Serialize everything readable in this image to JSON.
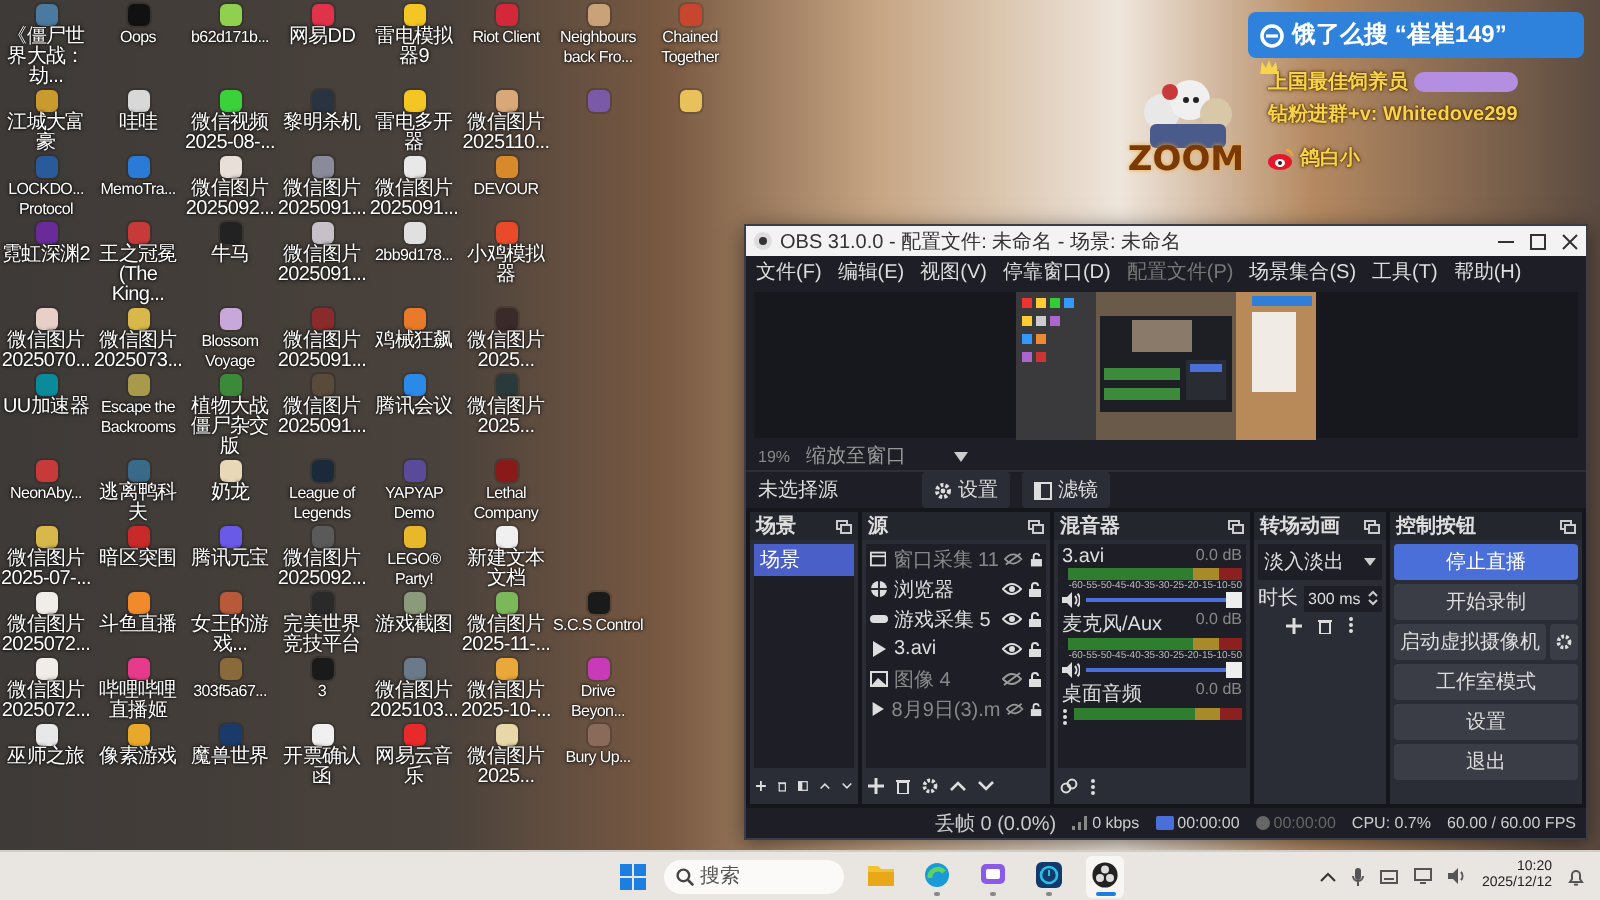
{
  "desktop": {
    "rows": [
      [
        {
          "label": "《僵尸世界大战：劫...",
          "color": "#4a7aa0"
        },
        {
          "label": "Oops",
          "color": "#111111"
        },
        {
          "label": "b62d171b...",
          "color": "#8fd14f"
        },
        {
          "label": "网易DD",
          "color": "#e0334a"
        },
        {
          "label": "雷电模拟器9",
          "color": "#f3c623"
        },
        {
          "label": "Riot Client",
          "color": "#d3283a"
        },
        {
          "label": "Neighbours back Fro...",
          "color": "#c9a27a"
        },
        {
          "label": "Chained Together",
          "color": "#c8462e"
        }
      ],
      [
        {
          "label": "江城大富豪",
          "color": "#c99a2e"
        },
        {
          "label": "哇哇",
          "color": "#d8d8d8"
        },
        {
          "label": "微信视频 2025-08-...",
          "color": "#3bd13b"
        },
        {
          "label": "黎明杀机",
          "color": "#2a3440"
        },
        {
          "label": "雷电多开器",
          "color": "#f3c623"
        },
        {
          "label": "微信图片 2025110...",
          "color": "#d9a878"
        },
        {
          "color": "#7a5aa8"
        },
        {
          "color": "#e8c15a"
        }
      ],
      [
        {
          "label": "LOCKDO... Protocol",
          "color": "#2a5a9a"
        },
        {
          "label": "MemoTra...",
          "color": "#2a7ad8"
        },
        {
          "label": "微信图片 2025092...",
          "color": "#e8e0d8"
        },
        {
          "label": "微信图片 2025091...",
          "color": "#8a8a9a"
        },
        {
          "label": "微信图片 2025091...",
          "color": "#e8e8e8"
        },
        {
          "label": "DEVOUR",
          "color": "#d88a2a"
        }
      ],
      [
        {
          "label": "霓虹深渊2",
          "color": "#6a2a9a"
        },
        {
          "label": "王之冠冕 (The King...",
          "color": "#c83a3a"
        },
        {
          "label": "牛马",
          "color": "#222222"
        },
        {
          "label": "微信图片 2025091...",
          "color": "#c8c0c8"
        },
        {
          "label": "2bb9d178...",
          "color": "#e0e0e0"
        },
        {
          "label": "小鸡模拟器",
          "color": "#e84a2a"
        }
      ],
      [
        {
          "label": "微信图片 2025070...",
          "color": "#e8d0c8"
        },
        {
          "label": "微信图片 2025073...",
          "color": "#d8b84a"
        },
        {
          "label": "Blossom Voyage",
          "color": "#c8a8d8"
        },
        {
          "label": "微信图片 2025091...",
          "color": "#8a2a2a"
        },
        {
          "label": "鸡械狂飙",
          "color": "#e87a2a"
        },
        {
          "label": "微信图片 2025...",
          "color": "#3a2a2a"
        }
      ],
      [
        {
          "label": "UU加速器",
          "color": "#0a8a9a"
        },
        {
          "label": "Escape the Backrooms",
          "color": "#a89a4a"
        },
        {
          "label": "植物大战僵尸杂交版",
          "color": "#3a8a3a"
        },
        {
          "label": "微信图片 2025091...",
          "color": "#5a4a3a"
        },
        {
          "label": "腾讯会议",
          "color": "#2a8ae8"
        },
        {
          "label": "微信图片 2025...",
          "color": "#2a3a3a"
        }
      ],
      [
        {
          "label": "NeonAby...",
          "color": "#c83a3a"
        },
        {
          "label": "逃离鸭科夫",
          "color": "#3a6a8a"
        },
        {
          "label": "奶龙",
          "color": "#e8d8b8"
        },
        {
          "label": "League of Legends",
          "color": "#1a2a3a"
        },
        {
          "label": "YAPYAP Demo",
          "color": "#5a4a9a"
        },
        {
          "label": "Lethal Company",
          "color": "#8a1a1a"
        }
      ],
      [
        {
          "label": "微信图片 2025-07-...",
          "color": "#d8b84a"
        },
        {
          "label": "暗区突围",
          "color": "#c82a2a"
        },
        {
          "label": "腾讯元宝",
          "color": "#6a5ae8"
        },
        {
          "label": "微信图片 2025092...",
          "color": "#5a5a5a"
        },
        {
          "label": "LEGO® Party!",
          "color": "#e8b82a"
        },
        {
          "label": "新建文本文档",
          "color": "#f0f0f0"
        }
      ],
      [
        {
          "label": "微信图片 2025072...",
          "color": "#f0ece8"
        },
        {
          "label": "斗鱼直播",
          "color": "#f08a2a"
        },
        {
          "label": "女王的游戏...",
          "color": "#b85a3a"
        },
        {
          "label": "完美世界竞技平台",
          "color": "#2a2a2a"
        },
        {
          "label": "游戏截图",
          "color": "#8a9a7a"
        },
        {
          "label": "微信图片 2025-11-...",
          "color": "#7ab85a"
        },
        {
          "label": "S.C.S Control",
          "color": "#1a1a1a"
        }
      ],
      [
        {
          "label": "微信图片 2025072...",
          "color": "#f0ece8"
        },
        {
          "label": "哔哩哔哩直播姬",
          "color": "#e83a8a"
        },
        {
          "label": "303f5a67...",
          "color": "#8a6a3a"
        },
        {
          "label": "3",
          "color": "#1a1a1a"
        },
        {
          "label": "微信图片 2025103...",
          "color": "#6a7a8a"
        },
        {
          "label": "微信图片 2025-10-...",
          "color": "#e8a83a"
        },
        {
          "label": "Drive Beyon...",
          "color": "#c83ab8"
        }
      ],
      [
        {
          "label": "巫师之旅",
          "color": "#e8e8e8"
        },
        {
          "label": "像素游戏",
          "color": "#e8a82a"
        },
        {
          "label": "魔兽世界",
          "color": "#1a3a6a"
        },
        {
          "label": "开票确认函",
          "color": "#f0f0f0"
        },
        {
          "label": "网易云音乐",
          "color": "#e82a2a"
        },
        {
          "label": "微信图片 2025...",
          "color": "#e8d8a8"
        },
        {
          "label": "Bury Up...",
          "color": "#8a6a5a"
        }
      ]
    ]
  },
  "obs": {
    "title": "OBS 31.0.0 - 配置文件: 未命名 - 场景: 未命名",
    "menu": [
      {
        "label": "文件(F)",
        "disabled": false
      },
      {
        "label": "编辑(E)",
        "disabled": false
      },
      {
        "label": "视图(V)",
        "disabled": false
      },
      {
        "label": "停靠窗口(D)",
        "disabled": false
      },
      {
        "label": "配置文件(P)",
        "disabled": true
      },
      {
        "label": "场景集合(S)",
        "disabled": false
      },
      {
        "label": "工具(T)",
        "disabled": false
      },
      {
        "label": "帮助(H)",
        "disabled": false
      }
    ],
    "zoom": "19%",
    "scale_mode": "缩放至窗口",
    "source_label": "未选择源",
    "toolbar_buttons": [
      "设置",
      "滤镜"
    ],
    "scenes": {
      "title": "场景",
      "items": [
        {
          "label": "场景",
          "selected": true
        }
      ]
    },
    "sources": {
      "title": "源",
      "items": [
        {
          "label": "窗口采集 11",
          "kind": "window",
          "visible": false
        },
        {
          "label": "浏览器",
          "kind": "browser",
          "visible": true
        },
        {
          "label": "游戏采集 5",
          "kind": "game",
          "visible": true
        },
        {
          "label": "3.avi",
          "kind": "media",
          "visible": true
        },
        {
          "label": "图像 4",
          "kind": "image",
          "visible": false
        },
        {
          "label": "8月9日(3).m",
          "kind": "media",
          "visible": false
        }
      ]
    },
    "mixer": {
      "title": "混音器",
      "channels": [
        {
          "name": "3.avi",
          "reading": "0.0 dB",
          "level": 1,
          "scale": [
            "-60",
            "-55",
            "-50",
            "-45",
            "-40",
            "-35",
            "-30",
            "-25",
            "-20",
            "-15",
            "-10",
            "-5",
            "0"
          ]
        },
        {
          "name": "麦克风/Aux",
          "reading": "0.0 dB",
          "level": 1,
          "scale": [
            "-60",
            "-55",
            "-50",
            "-45",
            "-40",
            "-35",
            "-30",
            "-25",
            "-20",
            "-15",
            "-10",
            "-5",
            "0"
          ]
        },
        {
          "name": "桌面音频",
          "reading": "0.0 dB"
        }
      ]
    },
    "transitions": {
      "title": "转场动画",
      "selected": "淡入淡出",
      "duration_label": "时长",
      "duration": "300 ms"
    },
    "controls": {
      "title": "控制按钮",
      "buttons": [
        {
          "label": "停止直播",
          "active": true,
          "kind": "plain"
        },
        {
          "label": "开始录制",
          "active": false,
          "kind": "plain"
        },
        {
          "label": "启动虚拟摄像机",
          "active": false,
          "kind": "split"
        },
        {
          "label": "工作室模式",
          "active": false,
          "kind": "plain"
        },
        {
          "label": "设置",
          "active": false,
          "kind": "plain"
        },
        {
          "label": "退出",
          "active": false,
          "kind": "plain"
        }
      ]
    },
    "status_bar": [
      {
        "text": "丢帧 0 (0.0%)",
        "kind": "dropped",
        "disabled": false
      },
      {
        "text": "0 kbps",
        "kind": "bitrate",
        "disabled": false
      },
      {
        "text": "00:00:00",
        "kind": "stream",
        "disabled": false
      },
      {
        "text": "00:00:00",
        "kind": "record",
        "disabled": true
      },
      {
        "text": "CPU: 0.7%",
        "kind": "cpu",
        "disabled": false
      },
      {
        "text": "60.00 / 60.00 FPS",
        "kind": "fps",
        "disabled": false
      }
    ]
  },
  "overlay": {
    "promo": "饿了么搜 “崔崔149”",
    "title_line": "上国最佳饲养员",
    "contact_line": "钻粉进群+v: Whitedove299",
    "weibo": "鸽白小",
    "logo_text": "ZOOM"
  },
  "taskbar": {
    "search": {
      "placeholder": "搜索"
    },
    "apps": [
      {
        "kind": "files",
        "running": false,
        "active": false
      },
      {
        "kind": "edge",
        "running": true,
        "active": false
      },
      {
        "kind": "chat",
        "running": true,
        "active": false
      },
      {
        "kind": "clock",
        "running": true,
        "active": false
      },
      {
        "kind": "obs",
        "running": true,
        "active": true
      }
    ],
    "time": "10:20",
    "date": "2025/12/12"
  }
}
